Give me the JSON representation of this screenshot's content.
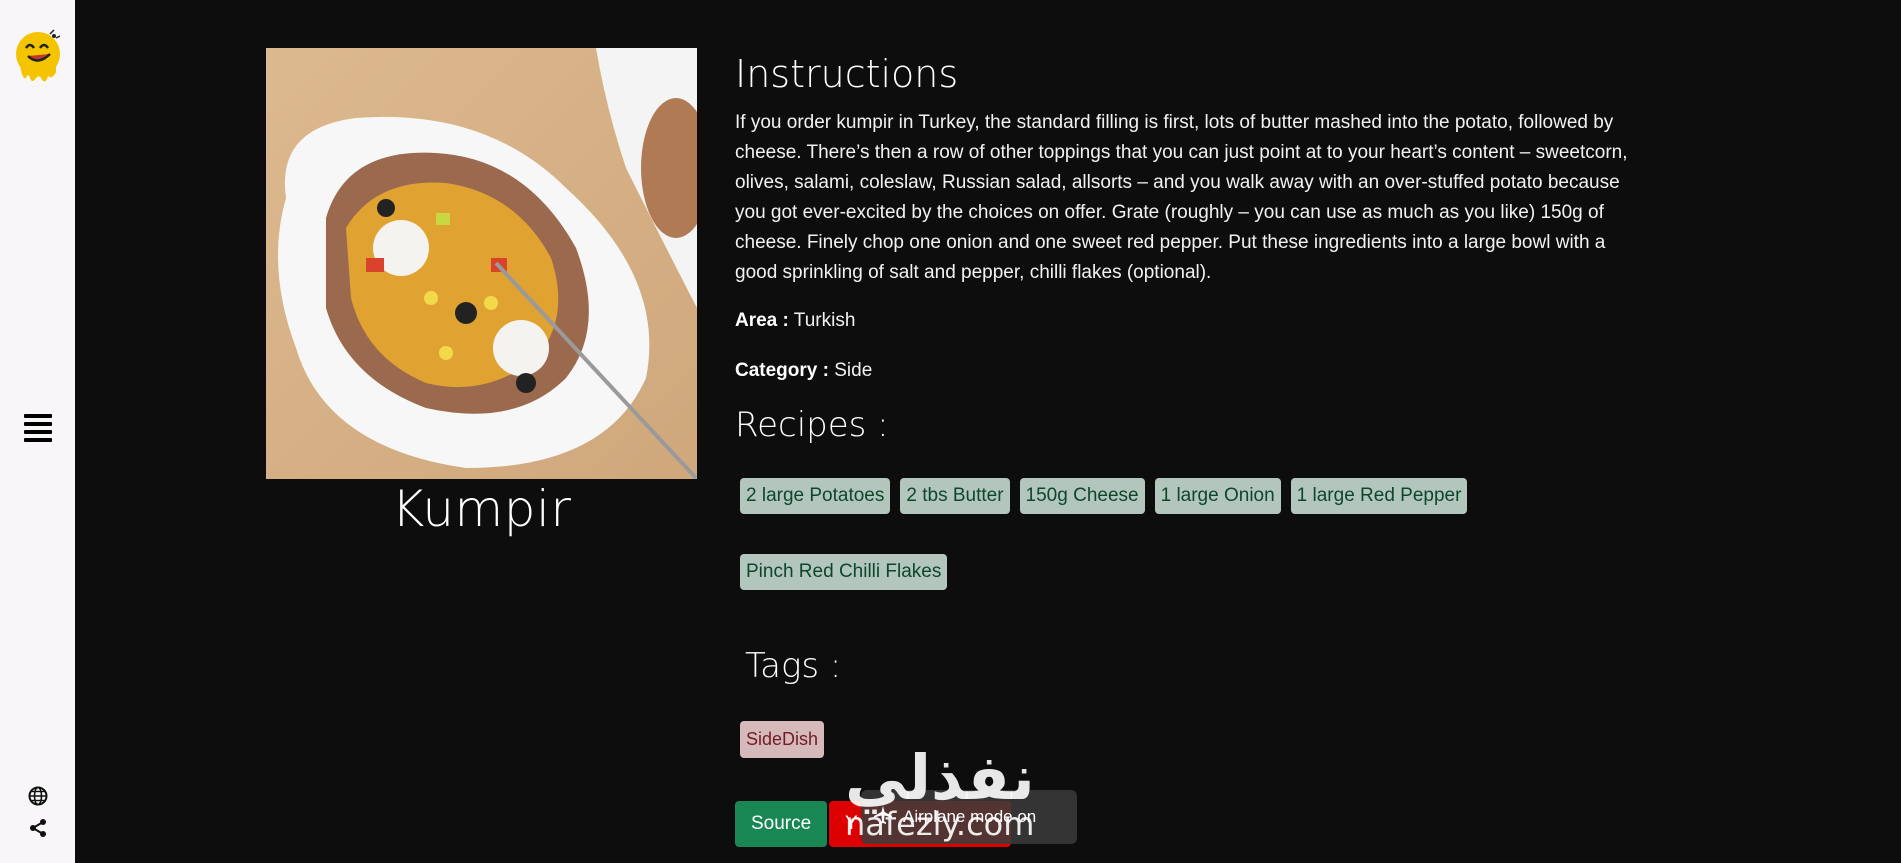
{
  "meal": {
    "name": "Kumpir",
    "image_alt": "Kumpir baked potato with toppings"
  },
  "instructions": {
    "title": "Instructions",
    "text": "If you order kumpir in Turkey, the standard filling is first, lots of butter mashed into the potato, followed by cheese. There’s then a row of other toppings that you can just point at to your heart’s content – sweetcorn, olives, salami, coleslaw, Russian salad, allsorts – and you walk away with an over-stuffed potato because you got ever-excited by the choices on offer. Grate (roughly – you can use as much as you like) 150g of cheese. Finely chop one onion and one sweet red pepper. Put these ingredients into a large bowl with a good sprinkling of salt and pepper, chilli flakes (optional)."
  },
  "area": {
    "label": "Area :",
    "value": "Turkish"
  },
  "category": {
    "label": "Category :",
    "value": "Side"
  },
  "recipes": {
    "title": "Recipes :",
    "items": [
      "2 large Potatoes",
      "2 tbs Butter",
      "150g Cheese",
      "1 large Onion",
      "1 large Red Pepper",
      "Pinch Red Chilli Flakes"
    ]
  },
  "tags": {
    "title": "Tags :",
    "items": [
      "SideDish"
    ]
  },
  "buttons": {
    "source": "Source",
    "youtube": "Y"
  },
  "toast": {
    "text": "Airplane mode on"
  },
  "watermark": {
    "arabic": "نفذلي",
    "latin": "nafezly.com"
  },
  "sidebar": {
    "icons": [
      "logo-icon",
      "menu-icon",
      "globe-icon",
      "share-icon"
    ]
  },
  "colors": {
    "background": "#0d0d0d",
    "sidebar": "#f8f6f8",
    "ingredient_bg": "#d1e7dd",
    "tag_bg": "#f8d7da",
    "source_button": "#198754",
    "youtube_button": "#dc0000"
  }
}
